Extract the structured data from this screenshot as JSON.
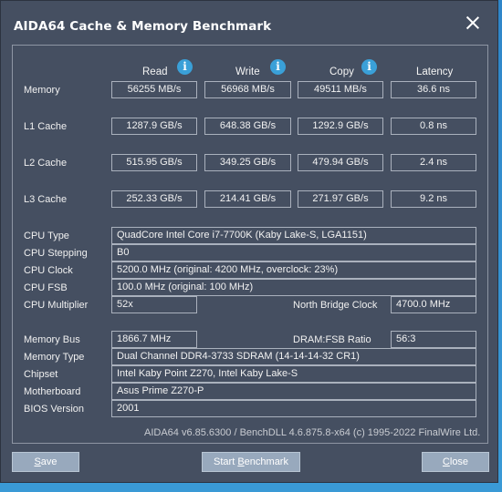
{
  "window": {
    "title": "AIDA64 Cache & Memory Benchmark"
  },
  "columns": {
    "read": "Read",
    "write": "Write",
    "copy": "Copy",
    "latency": "Latency"
  },
  "rows": {
    "memory": {
      "label": "Memory",
      "read": "56255 MB/s",
      "write": "56968 MB/s",
      "copy": "49511 MB/s",
      "latency": "36.6 ns"
    },
    "l1": {
      "label": "L1 Cache",
      "read": "1287.9 GB/s",
      "write": "648.38 GB/s",
      "copy": "1292.9 GB/s",
      "latency": "0.8 ns"
    },
    "l2": {
      "label": "L2 Cache",
      "read": "515.95 GB/s",
      "write": "349.25 GB/s",
      "copy": "479.94 GB/s",
      "latency": "2.4 ns"
    },
    "l3": {
      "label": "L3 Cache",
      "read": "252.33 GB/s",
      "write": "214.41 GB/s",
      "copy": "271.97 GB/s",
      "latency": "9.2 ns"
    }
  },
  "cpu": {
    "type_label": "CPU Type",
    "type_value": "QuadCore Intel Core i7-7700K  (Kaby Lake-S, LGA1151)",
    "stepping_label": "CPU Stepping",
    "stepping_value": "B0",
    "clock_label": "CPU Clock",
    "clock_value": "5200.0 MHz  (original: 4200 MHz, overclock: 23%)",
    "fsb_label": "CPU FSB",
    "fsb_value": "100.0 MHz  (original: 100 MHz)",
    "multiplier_label": "CPU Multiplier",
    "multiplier_value": "52x",
    "nb_clock_label": "North Bridge Clock",
    "nb_clock_value": "4700.0 MHz"
  },
  "system": {
    "bus_label": "Memory Bus",
    "bus_value": "1866.7 MHz",
    "ratio_label": "DRAM:FSB Ratio",
    "ratio_value": "56:3",
    "type_label": "Memory Type",
    "type_value": "Dual Channel DDR4-3733 SDRAM  (14-14-14-32 CR1)",
    "chipset_label": "Chipset",
    "chipset_value": "Intel Kaby Point Z270, Intel Kaby Lake-S",
    "motherboard_label": "Motherboard",
    "motherboard_value": "Asus Prime Z270-P",
    "bios_label": "BIOS Version",
    "bios_value": "2001"
  },
  "footer": {
    "text": "AIDA64 v6.85.6300 / BenchDLL 4.6.875.8-x64  (c) 1995-2022 FinalWire Ltd."
  },
  "buttons": {
    "save_u": "S",
    "save_rest": "ave",
    "start_pre": "Start ",
    "start_u": "B",
    "start_rest": "enchmark",
    "close_u": "C",
    "close_rest": "lose"
  }
}
